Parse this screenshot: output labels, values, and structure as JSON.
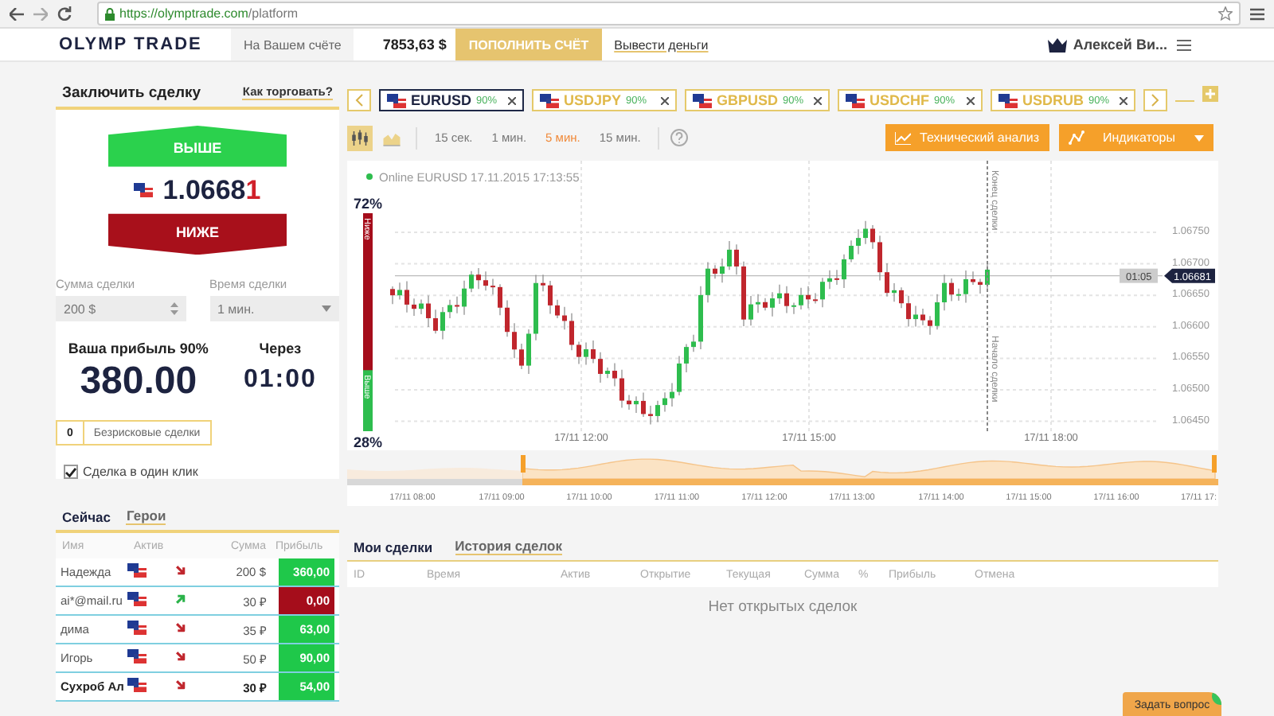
{
  "browser": {
    "url_host": "https://olymptrade.com",
    "url_path": "/platform"
  },
  "header": {
    "logo": "OLYMP TRADE",
    "balance_label": "На Вашем счёте",
    "balance": "7853,63 $",
    "deposit_button": "ПОПОЛНИТЬ СЧЁТ",
    "withdraw_link": "Вывести деньги",
    "user": "Алексей Ви..."
  },
  "trade_panel": {
    "title": "Заключить сделку",
    "help_link": "Как торговать?",
    "up_button": "ВЫШЕ",
    "price": "1.06681",
    "down_button": "НИЖЕ",
    "amount": {
      "label": "Сумма сделки",
      "value": "200 $"
    },
    "duration": {
      "label": "Время сделки",
      "value": "1 мин."
    },
    "profit_label": "Ваша прибыль 90%",
    "profit": "380.00",
    "expiry_label": "Через",
    "expiry": "01:00",
    "riskfree_count": "0",
    "riskfree_label": "Безрисковые сделки",
    "one_click": {
      "label": "Сделка в один клик",
      "checked": true
    }
  },
  "leaders": {
    "tabs": [
      {
        "label": "Сейчас",
        "selected": true
      },
      {
        "label": "Герои",
        "selected": false
      }
    ],
    "columns": [
      "Имя",
      "Актив",
      "Сумма",
      "Прибыль"
    ],
    "rows": [
      {
        "name": "Надежда",
        "kind": "down",
        "amount": "200 $",
        "profit": "360,00",
        "won": true,
        "highlighted": false
      },
      {
        "name": "ai*@mail.ru",
        "kind": "up",
        "amount": "30 ₽",
        "profit": "0,00",
        "won": false,
        "highlighted": false
      },
      {
        "name": "дима",
        "kind": "down",
        "amount": "35 ₽",
        "profit": "63,00",
        "won": true,
        "highlighted": false
      },
      {
        "name": "Игорь",
        "kind": "down",
        "amount": "50 ₽",
        "profit": "90,00",
        "won": true,
        "highlighted": false
      },
      {
        "name": "Сухроб Ал",
        "kind": "down",
        "amount": "30 ₽",
        "profit": "54,00",
        "won": true,
        "highlighted": true
      }
    ]
  },
  "asset_tabs": [
    {
      "pair": "EURUSD",
      "payout": "90%",
      "selected": true
    },
    {
      "pair": "USDJPY",
      "payout": "90%",
      "selected": false
    },
    {
      "pair": "GBPUSD",
      "payout": "90%",
      "selected": false
    },
    {
      "pair": "USDCHF",
      "payout": "90%",
      "selected": false
    },
    {
      "pair": "USDRUB",
      "payout": "90%",
      "selected": false
    }
  ],
  "toolbar": {
    "chart_types": [
      {
        "kind": "candles",
        "selected": true
      },
      {
        "kind": "area",
        "selected": false
      }
    ],
    "timeframes": [
      {
        "label": "15 сек.",
        "selected": false
      },
      {
        "label": "1 мин.",
        "selected": false
      },
      {
        "label": "5 мин.",
        "selected": true
      },
      {
        "label": "15 мин.",
        "selected": false
      }
    ],
    "analysis_button": "Технический анализ",
    "indicators_button": "Индикаторы"
  },
  "chart": {
    "status": "Online EURUSD 17.11.2015 17:13:55",
    "sentiment": {
      "top_percent": "72%",
      "bottom_percent": "28%",
      "down_label": "Ниже",
      "up_label": "Выше",
      "level": 0.72
    },
    "y_labels": [
      "1.06750",
      "1.06700",
      "1.06650",
      "1.06600",
      "1.06550",
      "1.06500",
      "1.06450"
    ],
    "current_price": "1.06681",
    "timer": "01:05",
    "x_labels": [
      "17/11 12:00",
      "17/11 15:00",
      "17/11 18:00"
    ],
    "end_marker": "Конец сделки",
    "start_marker": "Начало сделки",
    "navigator_labels": [
      "17/11 08:00",
      "17/11 09:00",
      "17/11 10:00",
      "17/11 11:00",
      "17/11 12:00",
      "17/11 13:00",
      "17/11 14:00",
      "17/11 15:00",
      "17/11 16:00",
      "17/11 17:"
    ]
  },
  "deals": {
    "tabs": [
      {
        "label": "Мои сделки",
        "selected": true
      },
      {
        "label": "История сделок",
        "selected": false
      }
    ],
    "columns": [
      "ID",
      "Время",
      "Актив",
      "Открытие",
      "Текущая",
      "Сумма",
      "%",
      "Прибыль",
      "Отмена"
    ],
    "empty_message": "Нет открытых сделок"
  },
  "help_button": "Задать вопрос"
}
